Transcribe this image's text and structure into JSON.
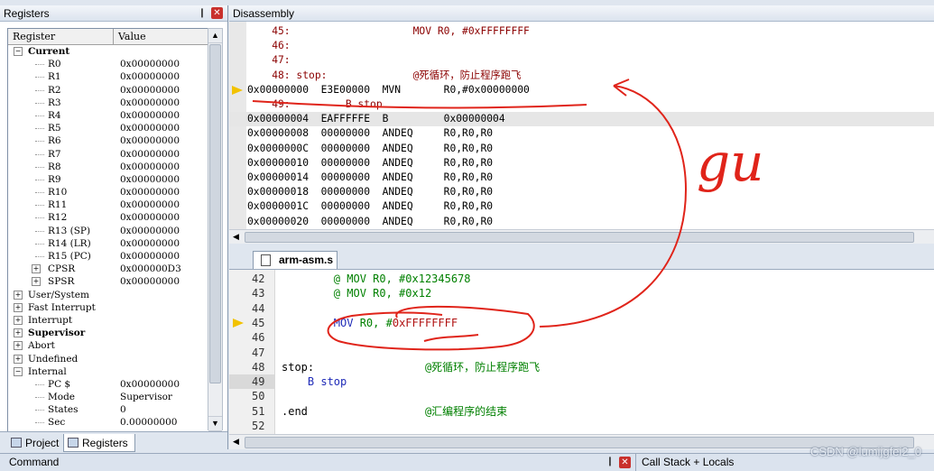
{
  "registers_panel": {
    "title": "Registers",
    "columns": [
      "Register",
      "Value"
    ],
    "rows": [
      {
        "name": "Current",
        "value": "",
        "level": 0,
        "expand": "-",
        "bold": true
      },
      {
        "name": "R0",
        "value": "0x00000000",
        "level": 1
      },
      {
        "name": "R1",
        "value": "0x00000000",
        "level": 1
      },
      {
        "name": "R2",
        "value": "0x00000000",
        "level": 1
      },
      {
        "name": "R3",
        "value": "0x00000000",
        "level": 1
      },
      {
        "name": "R4",
        "value": "0x00000000",
        "level": 1
      },
      {
        "name": "R5",
        "value": "0x00000000",
        "level": 1
      },
      {
        "name": "R6",
        "value": "0x00000000",
        "level": 1
      },
      {
        "name": "R7",
        "value": "0x00000000",
        "level": 1
      },
      {
        "name": "R8",
        "value": "0x00000000",
        "level": 1
      },
      {
        "name": "R9",
        "value": "0x00000000",
        "level": 1
      },
      {
        "name": "R10",
        "value": "0x00000000",
        "level": 1
      },
      {
        "name": "R11",
        "value": "0x00000000",
        "level": 1
      },
      {
        "name": "R12",
        "value": "0x00000000",
        "level": 1
      },
      {
        "name": "R13 (SP)",
        "value": "0x00000000",
        "level": 1
      },
      {
        "name": "R14 (LR)",
        "value": "0x00000000",
        "level": 1
      },
      {
        "name": "R15 (PC)",
        "value": "0x00000000",
        "level": 1
      },
      {
        "name": "CPSR",
        "value": "0x000000D3",
        "level": 1,
        "expand": "+"
      },
      {
        "name": "SPSR",
        "value": "0x00000000",
        "level": 1,
        "expand": "+"
      },
      {
        "name": "User/System",
        "value": "",
        "level": 0,
        "expand": "+"
      },
      {
        "name": "Fast Interrupt",
        "value": "",
        "level": 0,
        "expand": "+"
      },
      {
        "name": "Interrupt",
        "value": "",
        "level": 0,
        "expand": "+"
      },
      {
        "name": "Supervisor",
        "value": "",
        "level": 0,
        "expand": "+",
        "bold": true
      },
      {
        "name": "Abort",
        "value": "",
        "level": 0,
        "expand": "+"
      },
      {
        "name": "Undefined",
        "value": "",
        "level": 0,
        "expand": "+"
      },
      {
        "name": "Internal",
        "value": "",
        "level": 0,
        "expand": "-"
      },
      {
        "name": "PC  $",
        "value": "0x00000000",
        "level": 1
      },
      {
        "name": "Mode",
        "value": "Supervisor",
        "level": 1
      },
      {
        "name": "States",
        "value": "0",
        "level": 1
      },
      {
        "name": "Sec",
        "value": "0.00000000",
        "level": 1
      }
    ],
    "tabs": [
      {
        "label": "Project"
      },
      {
        "label": "Registers"
      }
    ]
  },
  "disassembly_panel": {
    "title": "Disassembly",
    "lines": [
      {
        "text": "    45:                    MOV R0, #0xFFFFFFFF",
        "kind": "src"
      },
      {
        "text": "    46:",
        "kind": "src"
      },
      {
        "text": "    47:",
        "kind": "src"
      },
      {
        "text": "    48: stop:              @死循环，防止程序跑飞",
        "kind": "src"
      },
      {
        "text": "0x00000000  E3E00000  MVN       R0,#0x00000000",
        "kind": "asm",
        "current": true
      },
      {
        "text": "    49:         B stop",
        "kind": "src"
      },
      {
        "text": "0x00000004  EAFFFFFE  B         0x00000004",
        "kind": "asm",
        "hl": true
      },
      {
        "text": "0x00000008  00000000  ANDEQ     R0,R0,R0",
        "kind": "asm"
      },
      {
        "text": "0x0000000C  00000000  ANDEQ     R0,R0,R0",
        "kind": "asm"
      },
      {
        "text": "0x00000010  00000000  ANDEQ     R0,R0,R0",
        "kind": "asm"
      },
      {
        "text": "0x00000014  00000000  ANDEQ     R0,R0,R0",
        "kind": "asm"
      },
      {
        "text": "0x00000018  00000000  ANDEQ     R0,R0,R0",
        "kind": "asm"
      },
      {
        "text": "0x0000001C  00000000  ANDEQ     R0,R0,R0",
        "kind": "asm"
      },
      {
        "text": "0x00000020  00000000  ANDEQ     R0,R0,R0",
        "kind": "asm"
      }
    ]
  },
  "editor": {
    "tab_label": "arm-asm.s",
    "lines": [
      {
        "ln": "42",
        "code": [
          [
            "        @ MOV R0, #0x12345678",
            "cmt"
          ]
        ]
      },
      {
        "ln": "43",
        "code": [
          [
            "        @ MOV R0, #0x12",
            "cmt"
          ]
        ]
      },
      {
        "ln": "44",
        "code": []
      },
      {
        "ln": "45",
        "code": [
          [
            "        ",
            ""
          ],
          [
            "MOV",
            "kw"
          ],
          [
            " R0, #",
            "cmt"
          ],
          [
            "0xFFFFFFFF",
            "num"
          ]
        ],
        "current": true
      },
      {
        "ln": "46",
        "code": []
      },
      {
        "ln": "47",
        "code": []
      },
      {
        "ln": "48",
        "code": [
          [
            "stop:",
            ""
          ],
          [
            "                 @死循环，防止程序跑飞",
            "cmt"
          ]
        ]
      },
      {
        "ln": "49",
        "code": [
          [
            "    B stop",
            "kw"
          ]
        ],
        "hl": true
      },
      {
        "ln": "50",
        "code": []
      },
      {
        "ln": "51",
        "code": [
          [
            ".end",
            ""
          ],
          [
            "                  @汇编程序的结束",
            "cmt"
          ]
        ]
      },
      {
        "ln": "52",
        "code": []
      }
    ]
  },
  "bottom_bar": {
    "command_label": "Command",
    "callstack_label": "Call Stack + Locals"
  },
  "annotation": {
    "handwritten_text": "gu",
    "color": "#e0241a"
  },
  "watermark": "CSDN @lumijgfei2_0"
}
